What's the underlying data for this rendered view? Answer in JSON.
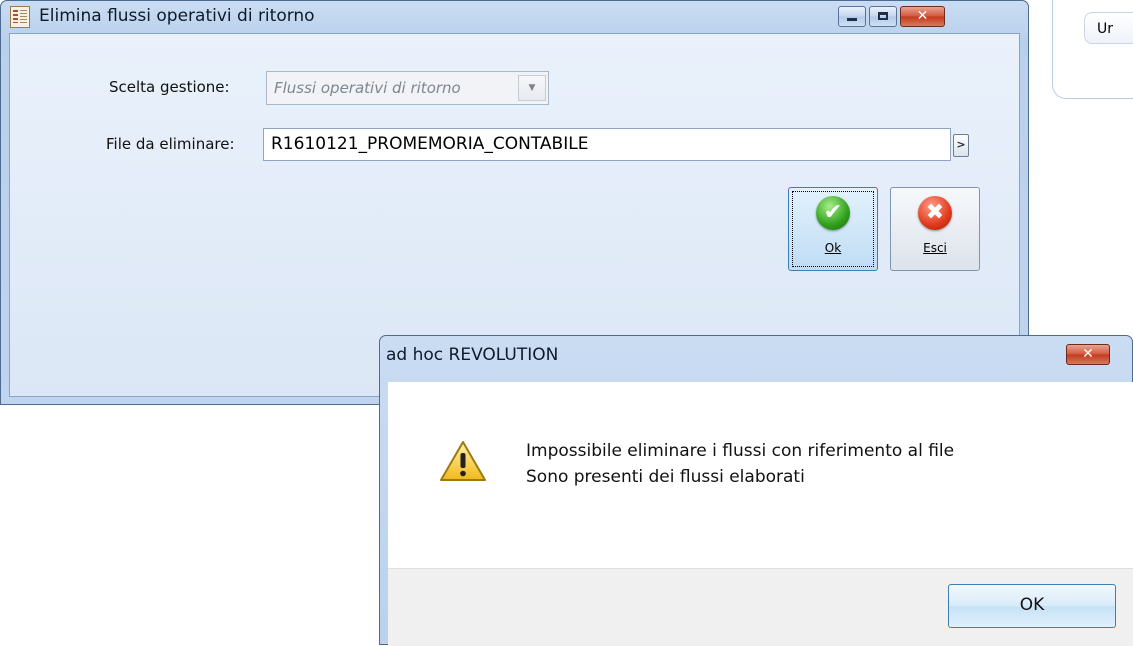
{
  "background": {
    "tab_label": "Ur"
  },
  "main_window": {
    "title": "Elimina flussi operativi di ritorno",
    "label_gestione": "Scelta gestione:",
    "gestione_value": "Flussi operativi di ritorno",
    "label_file": "File da eliminare:",
    "file_value": "R1610121_PROMEMORIA_CONTABILE",
    "ok_label": "Ok",
    "exit_label": "Esci"
  },
  "message_box": {
    "title": "ad hoc REVOLUTION",
    "line1": "Impossibile eliminare i flussi con riferimento al file",
    "line2": "Sono presenti dei flussi elaborati",
    "ok_label": "OK"
  },
  "colors": {
    "title_bar": "#bcd3ee",
    "close_button": "#c23a1e",
    "ok_icon": "#2f9f1c",
    "exit_icon": "#e03a1c",
    "warning": "#f4c430"
  }
}
